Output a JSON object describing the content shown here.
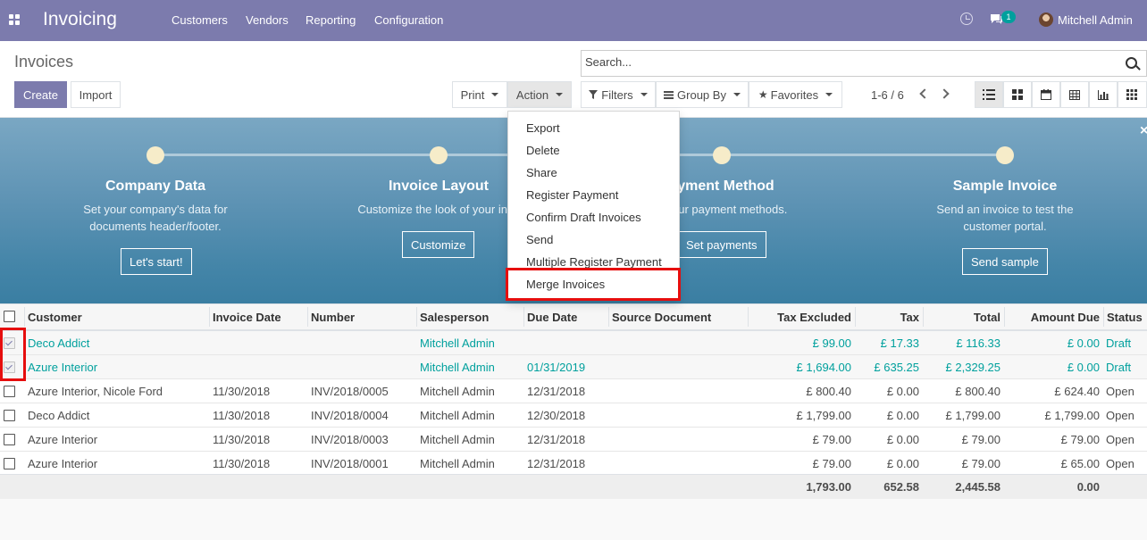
{
  "navbar": {
    "brand": "Invoicing",
    "menu": [
      "Customers",
      "Vendors",
      "Reporting",
      "Configuration"
    ],
    "chat_badge": "1",
    "user": "Mitchell Admin"
  },
  "control_panel": {
    "title": "Invoices",
    "create_label": "Create",
    "import_label": "Import",
    "print_label": "Print",
    "action_label": "Action",
    "search_placeholder": "Search...",
    "filters_label": "Filters",
    "groupby_label": "Group By",
    "favorites_label": "Favorites",
    "pager": "1-6 / 6"
  },
  "banner": {
    "steps": [
      {
        "title": "Company Data",
        "desc1": "Set your company's data for",
        "desc2": "documents header/footer.",
        "button": "Let's start!"
      },
      {
        "title": "Invoice Layout",
        "desc1": "Customize the look of your invo",
        "desc2": "",
        "button": "Customize"
      },
      {
        "title": "ayment Method",
        "desc1": "e your payment methods.",
        "desc2": "",
        "button": "Set payments"
      },
      {
        "title": "Sample Invoice",
        "desc1": "Send an invoice to test the",
        "desc2": "customer portal.",
        "button": "Send sample"
      }
    ],
    "close": "×"
  },
  "action_menu": {
    "items": [
      "Export",
      "Delete",
      "Share",
      "Register Payment",
      "Confirm Draft Invoices",
      "Send",
      "Multiple Register Payment",
      "Merge Invoices"
    ]
  },
  "table": {
    "headers": {
      "customer": "Customer",
      "invoice_date": "Invoice Date",
      "number": "Number",
      "salesperson": "Salesperson",
      "due_date": "Due Date",
      "source": "Source Document",
      "tax_excluded": "Tax Excluded",
      "tax": "Tax",
      "total": "Total",
      "amount_due": "Amount Due",
      "status": "Status"
    },
    "rows": [
      {
        "customer": "Deco Addict",
        "invoice_date": "",
        "number": "",
        "salesperson": "Mitchell Admin",
        "due_date": "",
        "tax_excluded": "£ 99.00",
        "tax": "£ 17.33",
        "total": "£ 116.33",
        "amount_due": "£ 0.00",
        "status": "Draft"
      },
      {
        "customer": "Azure Interior",
        "invoice_date": "",
        "number": "",
        "salesperson": "Mitchell Admin",
        "due_date": "01/31/2019",
        "tax_excluded": "£ 1,694.00",
        "tax": "£ 635.25",
        "total": "£ 2,329.25",
        "amount_due": "£ 0.00",
        "status": "Draft"
      },
      {
        "customer": "Azure Interior, Nicole Ford",
        "invoice_date": "11/30/2018",
        "number": "INV/2018/0005",
        "salesperson": "Mitchell Admin",
        "due_date": "12/31/2018",
        "tax_excluded": "£ 800.40",
        "tax": "£ 0.00",
        "total": "£ 800.40",
        "amount_due": "£ 624.40",
        "status": "Open"
      },
      {
        "customer": "Deco Addict",
        "invoice_date": "11/30/2018",
        "number": "INV/2018/0004",
        "salesperson": "Mitchell Admin",
        "due_date": "12/30/2018",
        "tax_excluded": "£ 1,799.00",
        "tax": "£ 0.00",
        "total": "£ 1,799.00",
        "amount_due": "£ 1,799.00",
        "status": "Open"
      },
      {
        "customer": "Azure Interior",
        "invoice_date": "11/30/2018",
        "number": "INV/2018/0003",
        "salesperson": "Mitchell Admin",
        "due_date": "12/31/2018",
        "tax_excluded": "£ 79.00",
        "tax": "£ 0.00",
        "total": "£ 79.00",
        "amount_due": "£ 79.00",
        "status": "Open"
      },
      {
        "customer": "Azure Interior",
        "invoice_date": "11/30/2018",
        "number": "INV/2018/0001",
        "salesperson": "Mitchell Admin",
        "due_date": "12/31/2018",
        "tax_excluded": "£ 79.00",
        "tax": "£ 0.00",
        "total": "£ 79.00",
        "amount_due": "£ 65.00",
        "status": "Open"
      }
    ],
    "totals": {
      "tax_excluded": "1,793.00",
      "tax": "652.58",
      "total": "2,445.58",
      "amount_due": "0.00"
    }
  },
  "colors": {
    "brand": "#7c7bad",
    "link": "#00a09d",
    "highlight": "#e60e0e"
  }
}
